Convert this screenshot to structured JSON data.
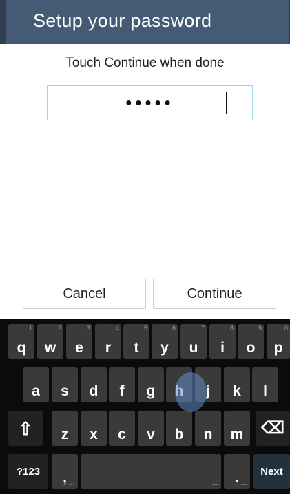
{
  "action_bar": {
    "title": "Setup your password"
  },
  "prompt": "Touch Continue when done",
  "password_field": {
    "masked_value": "•••••"
  },
  "buttons": {
    "cancel": "Cancel",
    "continue": "Continue"
  },
  "keyboard": {
    "row1": [
      {
        "label": "q",
        "hint": "1"
      },
      {
        "label": "w",
        "hint": "2"
      },
      {
        "label": "e",
        "hint": "3"
      },
      {
        "label": "r",
        "hint": "4"
      },
      {
        "label": "t",
        "hint": "5"
      },
      {
        "label": "y",
        "hint": "6"
      },
      {
        "label": "u",
        "hint": "7"
      },
      {
        "label": "i",
        "hint": "8"
      },
      {
        "label": "o",
        "hint": "9"
      },
      {
        "label": "p",
        "hint": "0"
      }
    ],
    "row2": [
      "a",
      "s",
      "d",
      "f",
      "g",
      "h",
      "j",
      "k",
      "l"
    ],
    "row3": [
      "z",
      "x",
      "c",
      "v",
      "b",
      "n",
      "m"
    ],
    "shift_label": "⇧",
    "backspace_label": "⌫",
    "symbols_label": "?123",
    "comma_label": ",",
    "period_label": ".",
    "next_label": "Next"
  }
}
